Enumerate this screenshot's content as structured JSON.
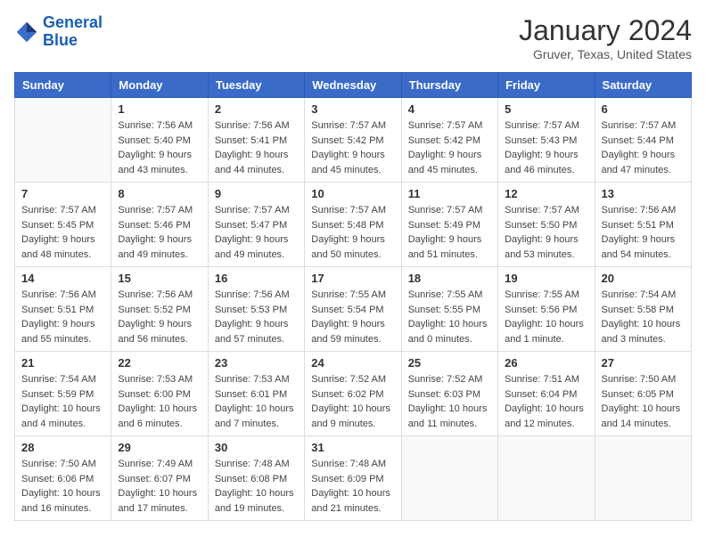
{
  "header": {
    "logo_line1": "General",
    "logo_line2": "Blue",
    "title": "January 2024",
    "subtitle": "Gruver, Texas, United States"
  },
  "columns": [
    "Sunday",
    "Monday",
    "Tuesday",
    "Wednesday",
    "Thursday",
    "Friday",
    "Saturday"
  ],
  "weeks": [
    [
      {
        "day": "",
        "sunrise": "",
        "sunset": "",
        "daylight": ""
      },
      {
        "day": "1",
        "sunrise": "Sunrise: 7:56 AM",
        "sunset": "Sunset: 5:40 PM",
        "daylight": "Daylight: 9 hours and 43 minutes."
      },
      {
        "day": "2",
        "sunrise": "Sunrise: 7:56 AM",
        "sunset": "Sunset: 5:41 PM",
        "daylight": "Daylight: 9 hours and 44 minutes."
      },
      {
        "day": "3",
        "sunrise": "Sunrise: 7:57 AM",
        "sunset": "Sunset: 5:42 PM",
        "daylight": "Daylight: 9 hours and 45 minutes."
      },
      {
        "day": "4",
        "sunrise": "Sunrise: 7:57 AM",
        "sunset": "Sunset: 5:42 PM",
        "daylight": "Daylight: 9 hours and 45 minutes."
      },
      {
        "day": "5",
        "sunrise": "Sunrise: 7:57 AM",
        "sunset": "Sunset: 5:43 PM",
        "daylight": "Daylight: 9 hours and 46 minutes."
      },
      {
        "day": "6",
        "sunrise": "Sunrise: 7:57 AM",
        "sunset": "Sunset: 5:44 PM",
        "daylight": "Daylight: 9 hours and 47 minutes."
      }
    ],
    [
      {
        "day": "7",
        "sunrise": "Sunrise: 7:57 AM",
        "sunset": "Sunset: 5:45 PM",
        "daylight": "Daylight: 9 hours and 48 minutes."
      },
      {
        "day": "8",
        "sunrise": "Sunrise: 7:57 AM",
        "sunset": "Sunset: 5:46 PM",
        "daylight": "Daylight: 9 hours and 49 minutes."
      },
      {
        "day": "9",
        "sunrise": "Sunrise: 7:57 AM",
        "sunset": "Sunset: 5:47 PM",
        "daylight": "Daylight: 9 hours and 49 minutes."
      },
      {
        "day": "10",
        "sunrise": "Sunrise: 7:57 AM",
        "sunset": "Sunset: 5:48 PM",
        "daylight": "Daylight: 9 hours and 50 minutes."
      },
      {
        "day": "11",
        "sunrise": "Sunrise: 7:57 AM",
        "sunset": "Sunset: 5:49 PM",
        "daylight": "Daylight: 9 hours and 51 minutes."
      },
      {
        "day": "12",
        "sunrise": "Sunrise: 7:57 AM",
        "sunset": "Sunset: 5:50 PM",
        "daylight": "Daylight: 9 hours and 53 minutes."
      },
      {
        "day": "13",
        "sunrise": "Sunrise: 7:56 AM",
        "sunset": "Sunset: 5:51 PM",
        "daylight": "Daylight: 9 hours and 54 minutes."
      }
    ],
    [
      {
        "day": "14",
        "sunrise": "Sunrise: 7:56 AM",
        "sunset": "Sunset: 5:51 PM",
        "daylight": "Daylight: 9 hours and 55 minutes."
      },
      {
        "day": "15",
        "sunrise": "Sunrise: 7:56 AM",
        "sunset": "Sunset: 5:52 PM",
        "daylight": "Daylight: 9 hours and 56 minutes."
      },
      {
        "day": "16",
        "sunrise": "Sunrise: 7:56 AM",
        "sunset": "Sunset: 5:53 PM",
        "daylight": "Daylight: 9 hours and 57 minutes."
      },
      {
        "day": "17",
        "sunrise": "Sunrise: 7:55 AM",
        "sunset": "Sunset: 5:54 PM",
        "daylight": "Daylight: 9 hours and 59 minutes."
      },
      {
        "day": "18",
        "sunrise": "Sunrise: 7:55 AM",
        "sunset": "Sunset: 5:55 PM",
        "daylight": "Daylight: 10 hours and 0 minutes."
      },
      {
        "day": "19",
        "sunrise": "Sunrise: 7:55 AM",
        "sunset": "Sunset: 5:56 PM",
        "daylight": "Daylight: 10 hours and 1 minute."
      },
      {
        "day": "20",
        "sunrise": "Sunrise: 7:54 AM",
        "sunset": "Sunset: 5:58 PM",
        "daylight": "Daylight: 10 hours and 3 minutes."
      }
    ],
    [
      {
        "day": "21",
        "sunrise": "Sunrise: 7:54 AM",
        "sunset": "Sunset: 5:59 PM",
        "daylight": "Daylight: 10 hours and 4 minutes."
      },
      {
        "day": "22",
        "sunrise": "Sunrise: 7:53 AM",
        "sunset": "Sunset: 6:00 PM",
        "daylight": "Daylight: 10 hours and 6 minutes."
      },
      {
        "day": "23",
        "sunrise": "Sunrise: 7:53 AM",
        "sunset": "Sunset: 6:01 PM",
        "daylight": "Daylight: 10 hours and 7 minutes."
      },
      {
        "day": "24",
        "sunrise": "Sunrise: 7:52 AM",
        "sunset": "Sunset: 6:02 PM",
        "daylight": "Daylight: 10 hours and 9 minutes."
      },
      {
        "day": "25",
        "sunrise": "Sunrise: 7:52 AM",
        "sunset": "Sunset: 6:03 PM",
        "daylight": "Daylight: 10 hours and 11 minutes."
      },
      {
        "day": "26",
        "sunrise": "Sunrise: 7:51 AM",
        "sunset": "Sunset: 6:04 PM",
        "daylight": "Daylight: 10 hours and 12 minutes."
      },
      {
        "day": "27",
        "sunrise": "Sunrise: 7:50 AM",
        "sunset": "Sunset: 6:05 PM",
        "daylight": "Daylight: 10 hours and 14 minutes."
      }
    ],
    [
      {
        "day": "28",
        "sunrise": "Sunrise: 7:50 AM",
        "sunset": "Sunset: 6:06 PM",
        "daylight": "Daylight: 10 hours and 16 minutes."
      },
      {
        "day": "29",
        "sunrise": "Sunrise: 7:49 AM",
        "sunset": "Sunset: 6:07 PM",
        "daylight": "Daylight: 10 hours and 17 minutes."
      },
      {
        "day": "30",
        "sunrise": "Sunrise: 7:48 AM",
        "sunset": "Sunset: 6:08 PM",
        "daylight": "Daylight: 10 hours and 19 minutes."
      },
      {
        "day": "31",
        "sunrise": "Sunrise: 7:48 AM",
        "sunset": "Sunset: 6:09 PM",
        "daylight": "Daylight: 10 hours and 21 minutes."
      },
      {
        "day": "",
        "sunrise": "",
        "sunset": "",
        "daylight": ""
      },
      {
        "day": "",
        "sunrise": "",
        "sunset": "",
        "daylight": ""
      },
      {
        "day": "",
        "sunrise": "",
        "sunset": "",
        "daylight": ""
      }
    ]
  ]
}
